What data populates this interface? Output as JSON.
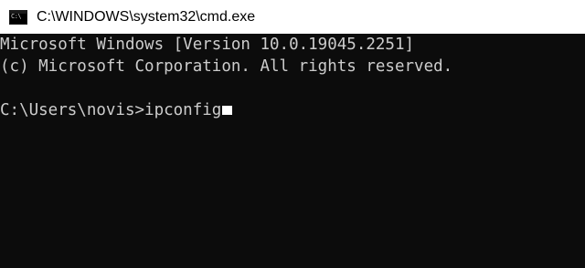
{
  "window": {
    "title": "C:\\WINDOWS\\system32\\cmd.exe",
    "icon_name": "cmd-icon",
    "icon_text": "C:\\"
  },
  "console": {
    "lines": [
      "Microsoft Windows [Version 10.0.19045.2251]",
      "(c) Microsoft Corporation. All rights reserved.",
      "",
      "C:\\Users\\novis>ipconfig"
    ]
  },
  "colors": {
    "console_background": "#0c0c0c",
    "console_text": "#cccccc",
    "titlebar_background": "#ffffff"
  }
}
